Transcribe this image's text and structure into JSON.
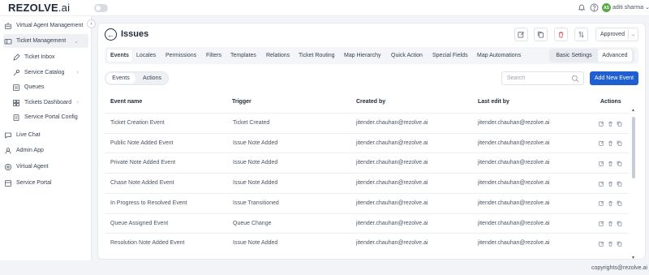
{
  "app": {
    "logo_text": "REZOLVE",
    "logo_suffix": ".ai"
  },
  "topbar": {
    "avatar_initials": "AS",
    "username": "aditi sharma"
  },
  "sidebar": {
    "items": [
      {
        "label": "Virtual Agent Management"
      },
      {
        "label": "Ticket Management"
      },
      {
        "label": "Ticket Inbox"
      },
      {
        "label": "Service Catalog"
      },
      {
        "label": "Queues"
      },
      {
        "label": "Tickets Dashboard"
      },
      {
        "label": "Service Portal Config"
      },
      {
        "label": "Live Chat"
      },
      {
        "label": "Admin App"
      },
      {
        "label": "Virtual Agent"
      },
      {
        "label": "Service Portal"
      }
    ]
  },
  "header": {
    "title": "Issues",
    "status": "Approved"
  },
  "tabs": [
    {
      "label": "Events"
    },
    {
      "label": "Locales"
    },
    {
      "label": "Permissions"
    },
    {
      "label": "Filters"
    },
    {
      "label": "Templates"
    },
    {
      "label": "Relations"
    },
    {
      "label": "Ticket Routing"
    },
    {
      "label": "Map Hierarchy"
    },
    {
      "label": "Quick Action"
    },
    {
      "label": "Special Fields"
    },
    {
      "label": "Map Automations"
    }
  ],
  "settings_toggle": {
    "basic": "Basic Settings",
    "advanced": "Advanced"
  },
  "sub_toggle": {
    "events": "Events",
    "actions": "Actions"
  },
  "search": {
    "placeholder": "Search",
    "value": ""
  },
  "add_button": "Add New Event",
  "table": {
    "columns": {
      "name": "Event name",
      "trigger": "Trigger",
      "created_by": "Created by",
      "last_edit": "Last edit by",
      "actions": "Actions"
    },
    "rows": [
      {
        "name": "Ticket Creation Event",
        "trigger": "Ticket Created",
        "created_by": "jitender.chauhan@rezolve.ai",
        "last_edit": "jitender.chauhan@rezolve.ai"
      },
      {
        "name": "Public Note Added Event",
        "trigger": "Issue Note Added",
        "created_by": "jitender.chauhan@rezolve.ai",
        "last_edit": "jitender.chauhan@rezolve.ai"
      },
      {
        "name": "Private Note Added Event",
        "trigger": "Issue Note Added",
        "created_by": "jitender.chauhan@rezolve.ai",
        "last_edit": "jitender.chauhan@rezolve.ai"
      },
      {
        "name": "Chase Note Added Event",
        "trigger": "Issue Note Added",
        "created_by": "jitender.chauhan@rezolve.ai",
        "last_edit": "jitender.chauhan@rezolve.ai"
      },
      {
        "name": "In Progress to Resolved Event",
        "trigger": "Issue Transitioned",
        "created_by": "jitender.chauhan@rezolve.ai",
        "last_edit": "jitender.chauhan@rezolve.ai"
      },
      {
        "name": "Queue Assigned Event",
        "trigger": "Queue Change",
        "created_by": "jitender.chauhan@rezolve.ai",
        "last_edit": "jitender.chauhan@rezolve.ai"
      },
      {
        "name": "Resolution Note Added Event",
        "trigger": "Issue Note Added",
        "created_by": "jitender.chauhan@rezolve.ai",
        "last_edit": "jitender.chauhan@rezolve.ai"
      }
    ]
  },
  "footer": {
    "copyright": "copyrights@rezolve.ai"
  },
  "colors": {
    "primary": "#1f5fd0",
    "danger": "#e05252",
    "avatar": "#5aa84a"
  }
}
